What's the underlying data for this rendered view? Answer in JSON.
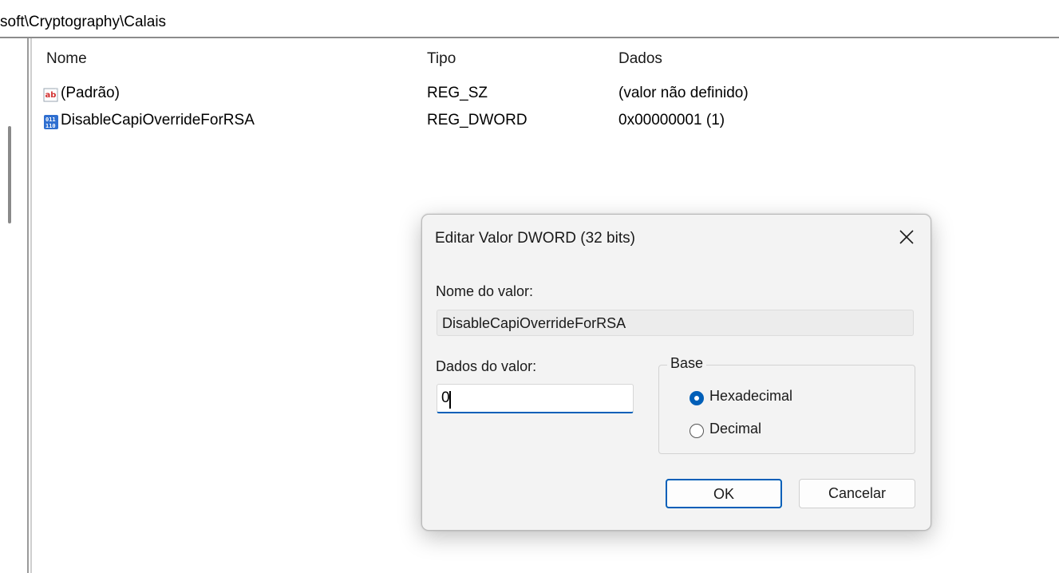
{
  "address_bar": {
    "path": "soft\\Cryptography\\Calais"
  },
  "list": {
    "columns": {
      "name": "Nome",
      "type": "Tipo",
      "data": "Dados"
    },
    "rows": [
      {
        "icon": "string-value-icon",
        "name": "(Padrão)",
        "type": "REG_SZ",
        "data": "(valor não definido)"
      },
      {
        "icon": "dword-value-icon",
        "name": "DisableCapiOverrideForRSA",
        "type": "REG_DWORD",
        "data": "0x00000001 (1)"
      }
    ]
  },
  "dialog": {
    "title": "Editar Valor DWORD (32 bits)",
    "value_name_label": "Nome do valor:",
    "value_name": "DisableCapiOverrideForRSA",
    "value_data_label": "Dados do valor:",
    "value_data": "0",
    "base_label": "Base",
    "base_options": [
      {
        "label": "Hexadecimal",
        "checked": true
      },
      {
        "label": "Decimal",
        "checked": false
      }
    ],
    "ok_label": "OK",
    "cancel_label": "Cancelar"
  },
  "colors": {
    "accent": "#005fb8",
    "dialog_bg": "#f3f3f3"
  }
}
